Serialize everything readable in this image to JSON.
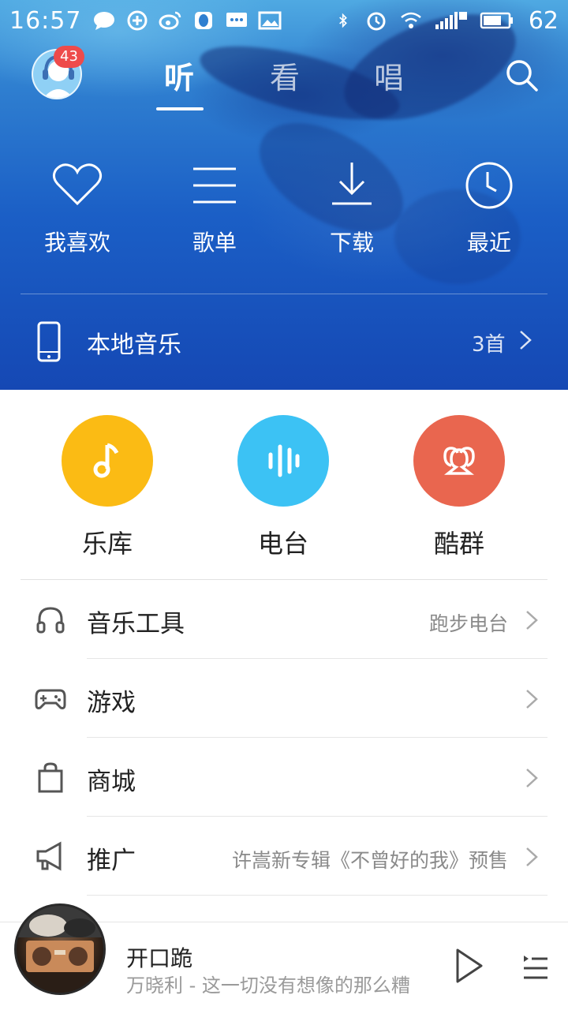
{
  "status_bar": {
    "time": "16:57",
    "battery": "62",
    "left_icons": [
      "chat-bubble-icon",
      "shield-plus-icon",
      "weibo-icon",
      "qq-icon",
      "sms-icon",
      "image-icon"
    ],
    "right_icons": [
      "bluetooth-icon",
      "alarm-icon",
      "wifi-icon",
      "signal-4g-icon",
      "battery-icon"
    ]
  },
  "header": {
    "avatar_badge": "43",
    "tabs": [
      {
        "label": "听",
        "active": true
      },
      {
        "label": "看",
        "active": false
      },
      {
        "label": "唱",
        "active": false
      }
    ],
    "search_icon": "search-icon"
  },
  "quick_actions": [
    {
      "label": "我喜欢",
      "icon": "heart-icon"
    },
    {
      "label": "歌单",
      "icon": "playlist-icon"
    },
    {
      "label": "下载",
      "icon": "download-icon"
    },
    {
      "label": "最近",
      "icon": "clock-icon"
    }
  ],
  "local_music": {
    "label": "本地音乐",
    "count": "3首"
  },
  "features": [
    {
      "label": "乐库",
      "icon": "music-note-icon",
      "color": "#fbbb14"
    },
    {
      "label": "电台",
      "icon": "radio-wave-icon",
      "color": "#3cc2f4"
    },
    {
      "label": "酷群",
      "icon": "group-icon",
      "color": "#e9664f"
    }
  ],
  "list": [
    {
      "label": "音乐工具",
      "extra": "跑步电台",
      "icon": "headphones-icon"
    },
    {
      "label": "游戏",
      "extra": "",
      "icon": "gamepad-icon"
    },
    {
      "label": "商城",
      "extra": "",
      "icon": "shopping-bag-icon"
    },
    {
      "label": "推广",
      "extra": "许嵩新专辑《不曾好的我》预售",
      "icon": "megaphone-icon"
    }
  ],
  "player": {
    "title": "开口跪",
    "subtitle": "万晓利 - 这一切没有想像的那么糟"
  }
}
